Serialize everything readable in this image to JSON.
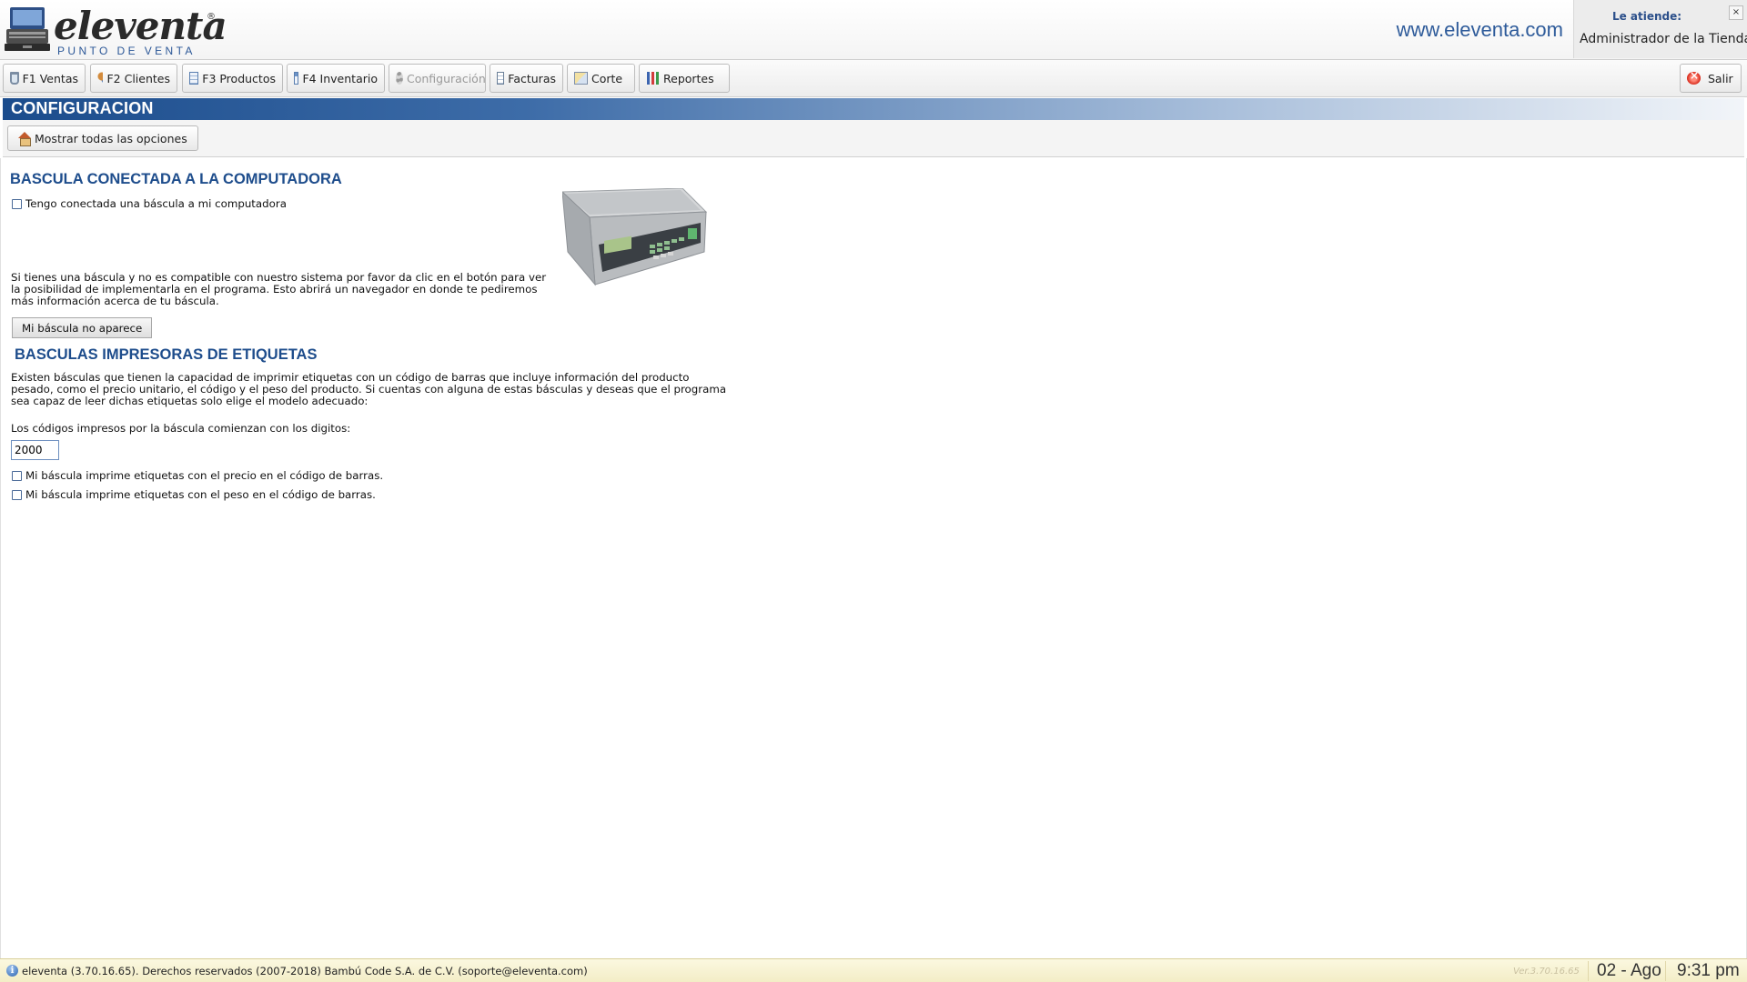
{
  "header": {
    "logo_word": "eleventa",
    "logo_registered": "®",
    "logo_subtitle": "PUNTO DE VENTA",
    "site_url": "www.eleventa.com",
    "attend_label": "Le atiende:",
    "attend_name": "Administrador de la Tienda",
    "close_glyph": "×"
  },
  "toolbar": {
    "buttons": [
      {
        "label": "F1 Ventas",
        "icon": "cart-icon"
      },
      {
        "label": "F2 Clientes",
        "icon": "clients-icon"
      },
      {
        "label": "F3 Productos",
        "icon": "products-icon"
      },
      {
        "label": "F4 Inventario",
        "icon": "inventory-icon"
      },
      {
        "label": "Configuración",
        "icon": "gear-icon",
        "disabled": true
      },
      {
        "label": "Facturas",
        "icon": "invoice-icon"
      },
      {
        "label": "Corte",
        "icon": "cut-icon"
      },
      {
        "label": "Reportes",
        "icon": "chart-icon"
      }
    ],
    "exit_label": "Salir"
  },
  "section": {
    "title": "CONFIGURACION",
    "show_all_label": "Mostrar todas las opciones"
  },
  "bascula": {
    "heading": "BASCULA CONECTADA A LA COMPUTADORA",
    "connected_checkbox": {
      "label": "Tengo conectada una báscula a mi computadora",
      "checked": false
    },
    "help_text": "Si tienes una báscula y no es compatible con nuestro sistema por favor da clic en el botón para ver la posibilidad de implementarla en el programa. Esto abrirá un navegador en donde te pediremos más información acerca de tu báscula.",
    "not_listed_button": "Mi báscula no aparece"
  },
  "impresoras": {
    "heading": "BASCULAS IMPRESORAS DE ETIQUETAS",
    "description": "Existen básculas que tienen la capacidad de imprimir etiquetas con un código de barras que incluye información del producto pesado, como el precio unitario, el código y el peso del producto. Si cuentas con alguna de estas básculas y deseas que el programa sea capaz de leer dichas etiquetas solo elige el modelo adecuado:",
    "prefix_label": "Los códigos impresos por la báscula comienzan con los digitos:",
    "prefix_value": "2000",
    "price_checkbox": {
      "label": "Mi báscula imprime etiquetas con el precio en el código de barras.",
      "checked": false
    },
    "weight_checkbox": {
      "label": "Mi báscula imprime etiquetas con el peso en el código de barras.",
      "checked": false
    }
  },
  "statusbar": {
    "info_glyph": "i",
    "text": "eleventa (3.70.16.65). Derechos reservados (2007-2018) Bambú Code S.A. de C.V. (soporte@eleventa.com)",
    "version": "Ver.3.70.16.65",
    "date": "02 - Ago",
    "time": "9:31 pm"
  },
  "colors": {
    "accent_blue": "#1e4d8c",
    "band_start": "#1b4c8c",
    "status_bg": "#fbf8e0"
  }
}
